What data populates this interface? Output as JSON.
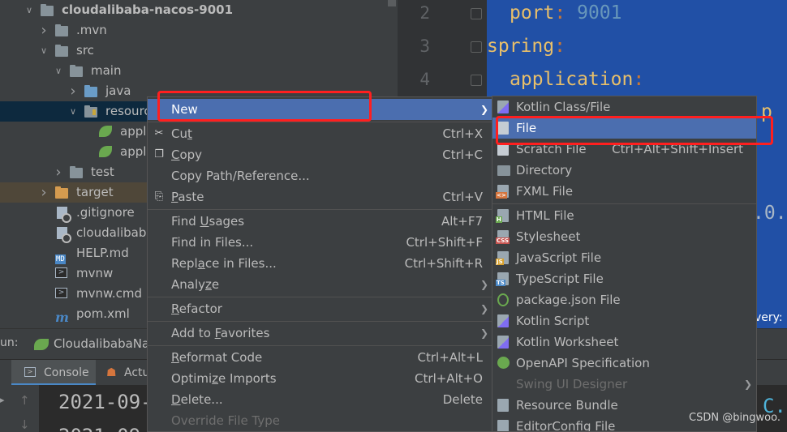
{
  "project_tree": {
    "rows": [
      {
        "label": "cloudalibaba-nacos-9001",
        "icon": "module-folder-icon",
        "arrow": "expanded",
        "bold": true
      },
      {
        "label": ".mvn",
        "icon": "folder-icon",
        "arrow": "collapsed"
      },
      {
        "label": "src",
        "icon": "folder-icon",
        "arrow": "expanded"
      },
      {
        "label": "main",
        "icon": "folder-icon",
        "arrow": "expanded"
      },
      {
        "label": "java",
        "icon": "source-folder-icon",
        "arrow": "collapsed"
      },
      {
        "label": "resource",
        "icon": "resources-folder-icon",
        "arrow": "expanded"
      },
      {
        "label": "appli",
        "icon": "spring-config-icon",
        "arrow": "none"
      },
      {
        "label": "appli",
        "icon": "spring-config-icon",
        "arrow": "none"
      },
      {
        "label": "test",
        "icon": "folder-icon",
        "arrow": "collapsed"
      },
      {
        "label": "target",
        "icon": "excluded-folder-icon",
        "arrow": "collapsed"
      },
      {
        "label": ".gitignore",
        "icon": "gitignore-file-icon",
        "arrow": "none"
      },
      {
        "label": "cloudalibaba-n",
        "icon": "file-icon",
        "arrow": "none"
      },
      {
        "label": "HELP.md",
        "icon": "markdown-file-icon",
        "arrow": "none"
      },
      {
        "label": "mvnw",
        "icon": "shell-file-icon",
        "arrow": "none"
      },
      {
        "label": "mvnw.cmd",
        "icon": "cmd-file-icon",
        "arrow": "none"
      },
      {
        "label": "pom.xml",
        "icon": "maven-file-icon",
        "arrow": "none"
      }
    ],
    "md_badge": "MD",
    "maven_glyph": "m"
  },
  "editor": {
    "line_numbers": [
      "2",
      "3",
      "4"
    ],
    "lines": [
      {
        "key": "port",
        "sep": ": ",
        "value": "9001"
      },
      {
        "key": "spring",
        "sep": ":",
        "value": ""
      },
      {
        "key": "application",
        "sep": ":",
        "value": ""
      }
    ],
    "fragments": [
      "p",
      ".0.",
      "very:",
      "C."
    ]
  },
  "run_panel": {
    "run_label": "un:",
    "config_name": "CloudalibabaNa",
    "tabs": [
      "Console",
      "Actu"
    ],
    "console_lines": [
      "2021-09-",
      "2021-09"
    ]
  },
  "context_menu": {
    "items": [
      {
        "type": "item",
        "label": "New",
        "submenu": true,
        "highlighted": true
      },
      {
        "type": "sep"
      },
      {
        "type": "item",
        "label": "Cut",
        "shortcut": "Ctrl+X",
        "icon": "scissors-icon",
        "mnemonic": "t"
      },
      {
        "type": "item",
        "label": "Copy",
        "shortcut": "Ctrl+C",
        "icon": "copy-icon",
        "mnemonic": "C"
      },
      {
        "type": "item",
        "label": "Copy Path/Reference..."
      },
      {
        "type": "item",
        "label": "Paste",
        "shortcut": "Ctrl+V",
        "icon": "paste-icon",
        "mnemonic": "P"
      },
      {
        "type": "sep"
      },
      {
        "type": "item",
        "label": "Find Usages",
        "shortcut": "Alt+F7",
        "mnemonic": "U"
      },
      {
        "type": "item",
        "label": "Find in Files...",
        "shortcut": "Ctrl+Shift+F"
      },
      {
        "type": "item",
        "label": "Replace in Files...",
        "shortcut": "Ctrl+Shift+R",
        "mnemonic": "a"
      },
      {
        "type": "item",
        "label": "Analyze",
        "submenu": true,
        "mnemonic": "z"
      },
      {
        "type": "sep"
      },
      {
        "type": "item",
        "label": "Refactor",
        "submenu": true,
        "mnemonic": "R"
      },
      {
        "type": "sep"
      },
      {
        "type": "item",
        "label": "Add to Favorites",
        "submenu": true,
        "mnemonic": "F"
      },
      {
        "type": "sep"
      },
      {
        "type": "item",
        "label": "Reformat Code",
        "shortcut": "Ctrl+Alt+L",
        "mnemonic": "R"
      },
      {
        "type": "item",
        "label": "Optimize Imports",
        "shortcut": "Ctrl+Alt+O",
        "mnemonic": "z"
      },
      {
        "type": "item",
        "label": "Delete...",
        "shortcut": "Delete",
        "mnemonic": "D"
      },
      {
        "type": "item",
        "label": "Override File Type",
        "disabled": true
      }
    ]
  },
  "new_submenu": {
    "items": [
      {
        "type": "item",
        "label": "Kotlin Class/File",
        "icon": "kotlin-file-icon"
      },
      {
        "type": "item",
        "label": "File",
        "icon": "text-file-icon",
        "highlighted": true
      },
      {
        "type": "item",
        "label": "Scratch File",
        "shortcut": "Ctrl+Alt+Shift+Insert",
        "icon": "scratch-file-icon"
      },
      {
        "type": "item",
        "label": "Directory",
        "icon": "directory-icon"
      },
      {
        "type": "item",
        "label": "FXML File",
        "icon": "fxml-file-icon"
      },
      {
        "type": "sep"
      },
      {
        "type": "item",
        "label": "HTML File",
        "icon": "html-file-icon"
      },
      {
        "type": "item",
        "label": "Stylesheet",
        "icon": "css-file-icon"
      },
      {
        "type": "item",
        "label": "JavaScript File",
        "icon": "javascript-file-icon"
      },
      {
        "type": "item",
        "label": "TypeScript File",
        "icon": "typescript-file-icon"
      },
      {
        "type": "item",
        "label": "package.json File",
        "icon": "nodejs-icon"
      },
      {
        "type": "item",
        "label": "Kotlin Script",
        "icon": "kotlin-script-icon"
      },
      {
        "type": "item",
        "label": "Kotlin Worksheet",
        "icon": "kotlin-worksheet-icon"
      },
      {
        "type": "item",
        "label": "OpenAPI Specification",
        "icon": "openapi-icon"
      },
      {
        "type": "item",
        "label": "Swing UI Designer",
        "submenu": true,
        "disabled": true
      },
      {
        "type": "item",
        "label": "Resource Bundle",
        "icon": "resource-bundle-icon"
      },
      {
        "type": "item",
        "label": "EditorConfig File",
        "icon": "editorconfig-icon"
      }
    ]
  },
  "watermark": "CSDN @bingwoo.",
  "colors": {
    "menu_bg": "#3c3f41",
    "highlight": "#4b6eaf",
    "editor_selection": "#2150a6",
    "annotation_red": "#ff1f1f"
  }
}
